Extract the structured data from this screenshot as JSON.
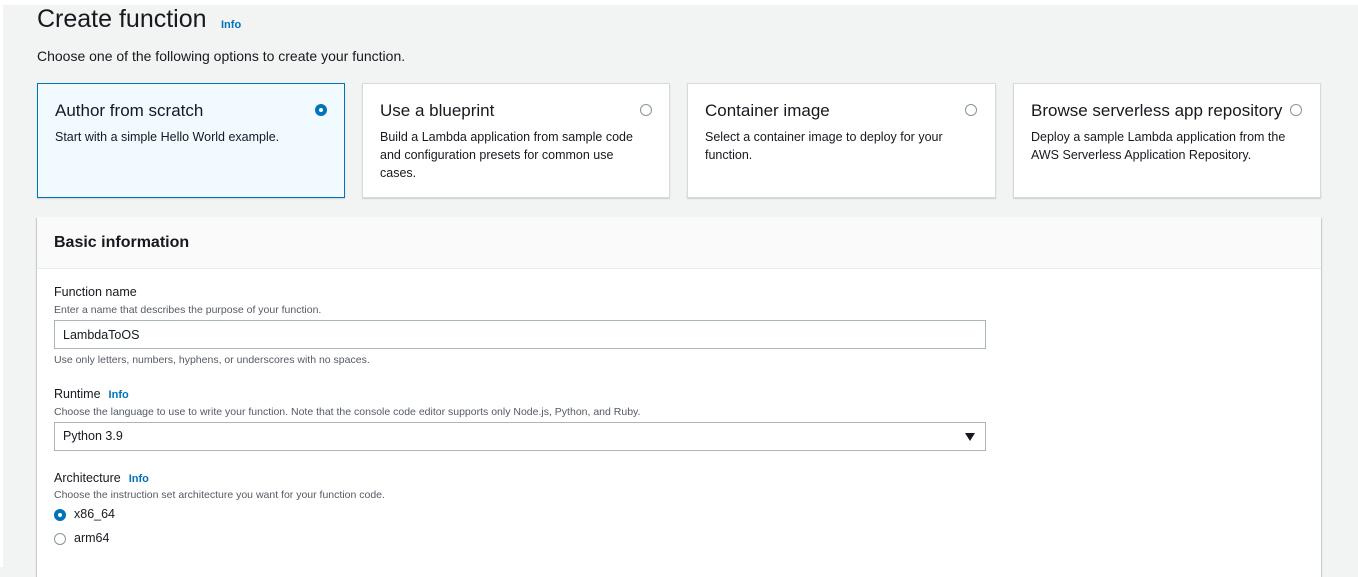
{
  "header": {
    "title": "Create function",
    "info": "Info",
    "subtitle": "Choose one of the following options to create your function."
  },
  "options": [
    {
      "title": "Author from scratch",
      "description": "Start with a simple Hello World example.",
      "selected": true
    },
    {
      "title": "Use a blueprint",
      "description": "Build a Lambda application from sample code and configuration presets for common use cases.",
      "selected": false
    },
    {
      "title": "Container image",
      "description": "Select a container image to deploy for your function.",
      "selected": false
    },
    {
      "title": "Browse serverless app repository",
      "description": "Deploy a sample Lambda application from the AWS Serverless Application Repository.",
      "selected": false
    }
  ],
  "basic_info": {
    "title": "Basic information",
    "function_name": {
      "label": "Function name",
      "description": "Enter a name that describes the purpose of your function.",
      "value": "LambdaToOS",
      "constraint": "Use only letters, numbers, hyphens, or underscores with no spaces."
    },
    "runtime": {
      "label": "Runtime",
      "info": "Info",
      "description": "Choose the language to use to write your function. Note that the console code editor supports only Node.js, Python, and Ruby.",
      "value": "Python 3.9"
    },
    "architecture": {
      "label": "Architecture",
      "info": "Info",
      "description": "Choose the instruction set architecture you want for your function code.",
      "options": [
        {
          "label": "x86_64",
          "selected": true
        },
        {
          "label": "arm64",
          "selected": false
        }
      ]
    }
  },
  "colors": {
    "accent": "#0073bb",
    "selected_card_bg": "#f1faff",
    "page_bg": "#f2f3f3"
  }
}
